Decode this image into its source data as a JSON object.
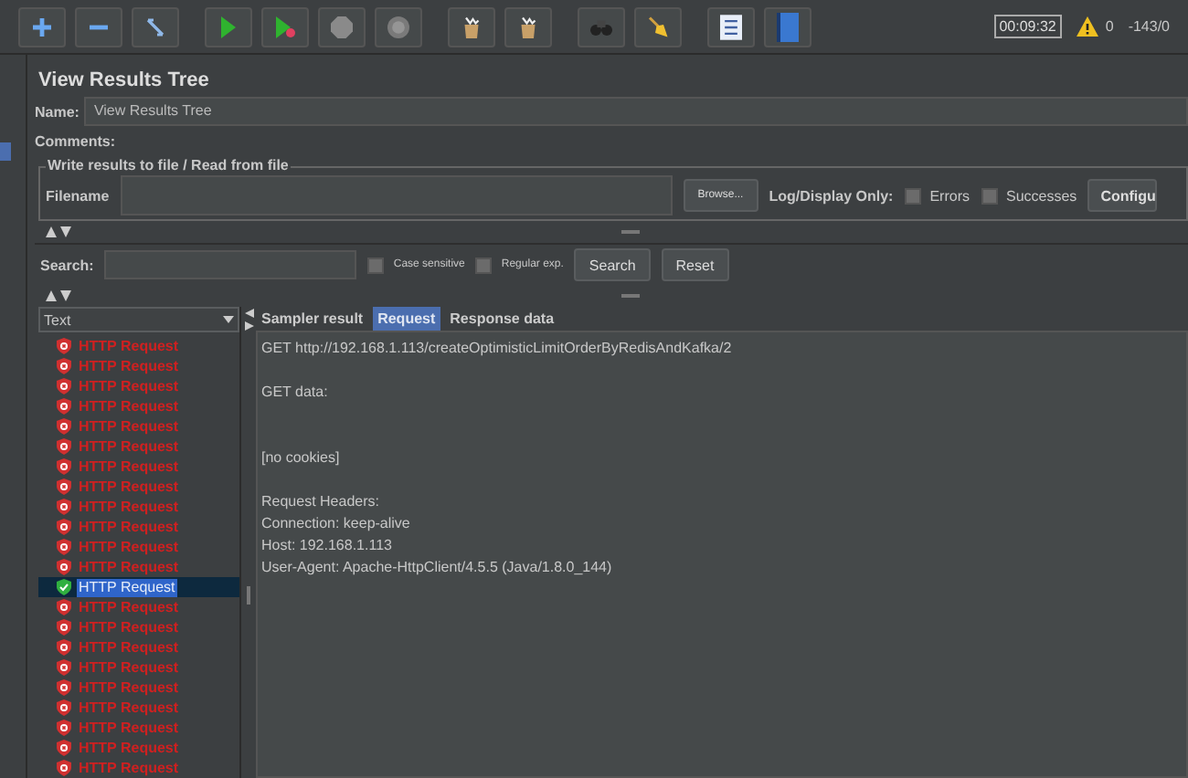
{
  "toolbar": {
    "groups": [
      [
        {
          "kind": "plus"
        },
        {
          "kind": "minus"
        },
        {
          "kind": "toggle"
        }
      ],
      [
        {
          "kind": "play"
        },
        {
          "kind": "play-dot"
        },
        {
          "kind": "octagon"
        },
        {
          "kind": "circle"
        }
      ],
      [
        {
          "kind": "bag"
        },
        {
          "kind": "bag"
        }
      ],
      [
        {
          "kind": "binoculars"
        },
        {
          "kind": "broom"
        }
      ],
      [
        {
          "kind": "list"
        },
        {
          "kind": "book"
        }
      ]
    ],
    "timer": "00:09:32",
    "warnings": "0",
    "threads": "-143/0"
  },
  "panel": {
    "title": "View Results Tree",
    "name": {
      "label": "Name:",
      "value": "View Results Tree"
    },
    "comments": {
      "label": "Comments:"
    },
    "file_group": {
      "legend": "Write results to file / Read from file",
      "filename_label": "Filename",
      "browse": "Browse...",
      "log_label": "Log/Display Only:",
      "options": [
        {
          "label": "Errors",
          "checked": false
        },
        {
          "label": "Successes",
          "checked": false
        }
      ],
      "configure": "Configu"
    },
    "search": {
      "label": "Search:",
      "options": [
        {
          "label": "Case sensitive",
          "checked": false
        },
        {
          "label": "Regular exp.",
          "checked": false
        }
      ],
      "search_button": "Search",
      "reset_button": "Reset"
    }
  },
  "tree": {
    "header": "Text",
    "rows": [
      {
        "label": "HTTP Request",
        "kind": "error",
        "selected": false
      },
      {
        "label": "HTTP Request",
        "kind": "error",
        "selected": false
      },
      {
        "label": "HTTP Request",
        "kind": "error",
        "selected": false
      },
      {
        "label": "HTTP Request",
        "kind": "error",
        "selected": false
      },
      {
        "label": "HTTP Request",
        "kind": "error",
        "selected": false
      },
      {
        "label": "HTTP Request",
        "kind": "error",
        "selected": false
      },
      {
        "label": "HTTP Request",
        "kind": "error",
        "selected": false
      },
      {
        "label": "HTTP Request",
        "kind": "error",
        "selected": false
      },
      {
        "label": "HTTP Request",
        "kind": "error",
        "selected": false
      },
      {
        "label": "HTTP Request",
        "kind": "error",
        "selected": false
      },
      {
        "label": "HTTP Request",
        "kind": "error",
        "selected": false
      },
      {
        "label": "HTTP Request",
        "kind": "error",
        "selected": false
      },
      {
        "label": "HTTP Request",
        "kind": "success",
        "selected": true
      },
      {
        "label": "HTTP Request",
        "kind": "error",
        "selected": false
      },
      {
        "label": "HTTP Request",
        "kind": "error",
        "selected": false
      },
      {
        "label": "HTTP Request",
        "kind": "error",
        "selected": false
      },
      {
        "label": "HTTP Request",
        "kind": "error",
        "selected": false
      },
      {
        "label": "HTTP Request",
        "kind": "error",
        "selected": false
      },
      {
        "label": "HTTP Request",
        "kind": "error",
        "selected": false
      },
      {
        "label": "HTTP Request",
        "kind": "error",
        "selected": false
      },
      {
        "label": "HTTP Request",
        "kind": "error",
        "selected": false
      },
      {
        "label": "HTTP Request",
        "kind": "error",
        "selected": false
      }
    ]
  },
  "details": {
    "tabs": [
      {
        "label": "Sampler result",
        "selected": false
      },
      {
        "label": "Request",
        "selected": true
      },
      {
        "label": "Response data",
        "selected": false
      }
    ],
    "blocks": [
      {
        "kind": "plain",
        "lines": [
          "GET http://192.168.1.113/createOptimisticLimitOrderByRedisAndKafka/2"
        ]
      },
      {
        "kind": "data",
        "lines": [
          "GET data:"
        ]
      },
      {
        "kind": "plain",
        "lines": [
          "[no cookies]"
        ]
      },
      {
        "kind": "plain",
        "lines": [
          "Request Headers:",
          "Connection: keep-alive",
          "Host: 192.168.1.113",
          "User-Agent: Apache-HttpClient/4.5.5 (Java/1.8.0_144)"
        ]
      }
    ]
  }
}
